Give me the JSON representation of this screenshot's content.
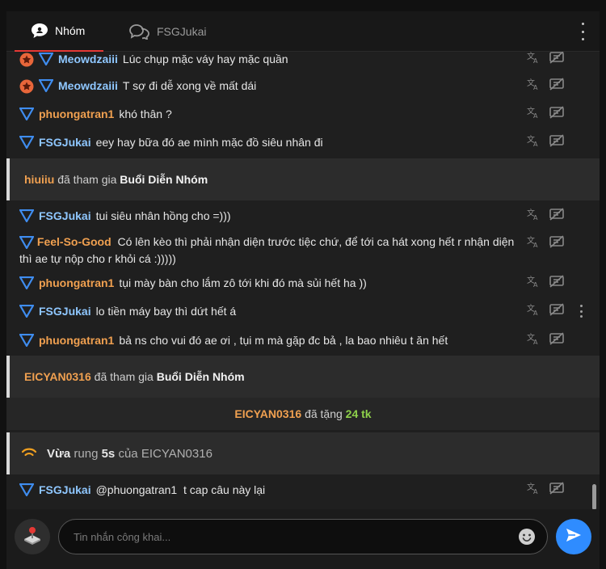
{
  "tabs": [
    {
      "label": "Nhóm",
      "icon": "group-chat-icon",
      "active": true
    },
    {
      "label": "FSGJukai",
      "icon": "chat-bubbles-icon",
      "active": false
    }
  ],
  "messages": [
    {
      "user": "Meowdzaiii",
      "text": "Lúc chụp mặc váy hay mặc quần",
      "badges": [
        "star-badge-icon",
        "triangle-badge-icon"
      ],
      "name_color": "blue"
    },
    {
      "user": "Meowdzaiii",
      "text": "T sợ đi dễ xong về mất dái",
      "badges": [
        "star-badge-icon",
        "triangle-badge-icon"
      ],
      "name_color": "blue"
    },
    {
      "user": "phuongatran1",
      "text": "khó thân ?",
      "badges": [
        "triangle-badge-icon"
      ],
      "name_color": "orange"
    },
    {
      "user": "FSGJukai",
      "text": "eey hay bữa đó ae mình mặc đồ siêu nhân đi",
      "badges": [
        "triangle-badge-icon"
      ],
      "name_color": "blue"
    }
  ],
  "join1": {
    "user": "hiuiiu",
    "action": "đã tham gia",
    "room": "Buổi Diễn Nhóm"
  },
  "messages2": [
    {
      "user": "FSGJukai",
      "text": "tui siêu nhân hồng cho =)))",
      "name_color": "blue"
    },
    {
      "user": "Feel-So-Good",
      "text": "Có lên kèo thì phải nhận diện trước tiệc chứ, để tới ca hát xong hết r nhận diện thì ae tự nộp cho r khỏi cá :)))))",
      "name_color": "orange"
    },
    {
      "user": "phuongatran1",
      "text": "tụi mày bàn cho lắm zô tới khi đó mà sủi hết ha ))",
      "name_color": "orange"
    },
    {
      "user": "FSGJukai",
      "text": "lo tiền máy bay thì dứt hết á",
      "name_color": "blue"
    },
    {
      "user": "phuongatran1",
      "text": "bả ns cho vui đó ae ơi , tụi m mà gặp đc bả , la bao nhiêu t ăn hết",
      "name_color": "orange"
    }
  ],
  "join2": {
    "user": "EICYAN0316",
    "action": "đã tham gia",
    "room": "Buổi Diễn Nhóm"
  },
  "gift": {
    "user": "EICYAN0316",
    "action": "đã tặng",
    "amount": "24 tk"
  },
  "buzz": {
    "label": "Vừa",
    "word": "rung",
    "duration": "5s",
    "of": "của",
    "user": "EICYAN0316"
  },
  "last_message": {
    "user": "FSGJukai",
    "text": "@phuongatran1  t cap câu này lại",
    "name_color": "blue"
  },
  "composer": {
    "placeholder": "Tin nhắn công khai..."
  },
  "colors": {
    "accent_blue": "#2f8cff",
    "name_blue": "#8fc7ff",
    "name_orange": "#f0a050",
    "gift_green": "#8ed14a",
    "tab_underline": "#e53935"
  }
}
